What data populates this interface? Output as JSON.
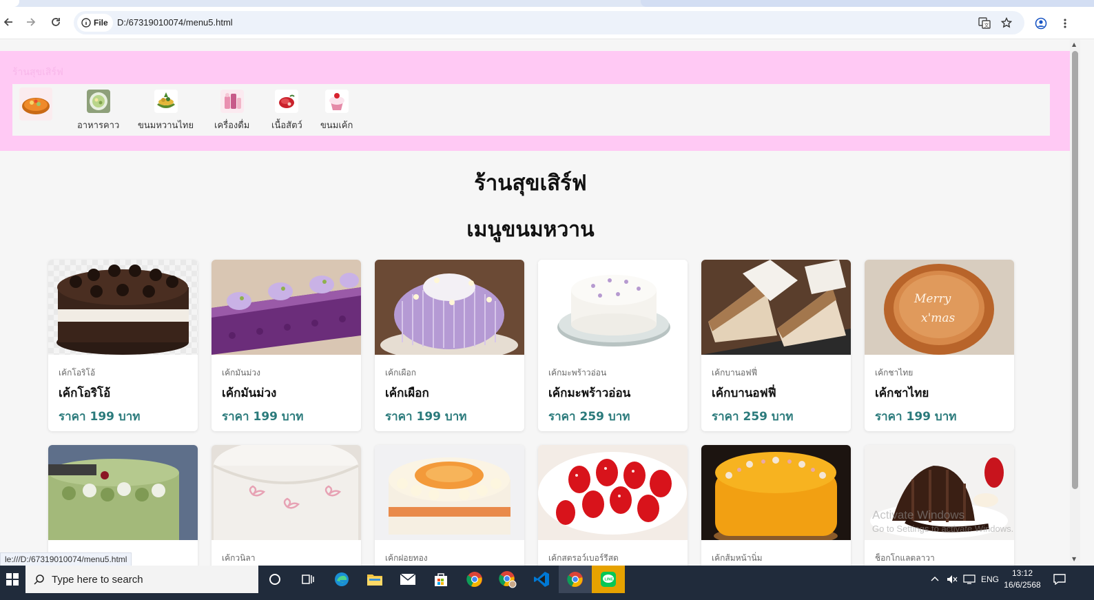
{
  "browser": {
    "chip_label": "File",
    "url": "D:/67319010074/menu5.html",
    "status_link": "le:///D:/67319010074/menu5.html"
  },
  "header": {
    "faint_text": "ร้านสุขเสิร์ฟ",
    "nav": [
      {
        "label": "",
        "icon": "food-bowl-icon"
      },
      {
        "label": "อาหารคาว",
        "icon": "savory-food-icon"
      },
      {
        "label": "ขนมหวานไทย",
        "icon": "thai-dessert-icon"
      },
      {
        "label": "เครื่องดื่ม",
        "icon": "drink-icon"
      },
      {
        "label": "เนื้อสัตว์",
        "icon": "meat-icon"
      },
      {
        "label": "ขนมเค้ก",
        "icon": "cake-icon"
      }
    ]
  },
  "main": {
    "shop_title": "ร้านสุขเสิร์ฟ",
    "menu_title": "เมนูขนมหวาน"
  },
  "cards": [
    {
      "category": "เค้กโอริโอ้",
      "name": "เค้กโอริโอ้",
      "price": "ราคา 199 บาท",
      "img": "oreo-cake-image"
    },
    {
      "category": "เค้กมันม่วง",
      "name": "เค้กมันม่วง",
      "price": "ราคา 199 บาท",
      "img": "purple-sweet-potato-cake-image"
    },
    {
      "category": "เค้กเผือก",
      "name": "เค้กเผือก",
      "price": "ราคา 199 บาท",
      "img": "taro-cake-image"
    },
    {
      "category": "เค้กมะพร้าวอ่อน",
      "name": "เค้กมะพร้าวอ่อน",
      "price": "ราคา 259 บาท",
      "img": "young-coconut-cake-image"
    },
    {
      "category": "เค้กบานอฟฟี่",
      "name": "เค้กบานอฟฟี่",
      "price": "ราคา 259 บาท",
      "img": "banoffee-cake-image"
    },
    {
      "category": "เค้กชาไทย",
      "name": "เค้กชาไทย",
      "price": "ราคา 199 บาท",
      "img": "thai-tea-cake-image"
    },
    {
      "category": "",
      "name": "",
      "price": "",
      "img": "green-tea-birthday-cake-image"
    },
    {
      "category": "เค้กวนิลา",
      "name": "",
      "price": "",
      "img": "vanilla-cake-image"
    },
    {
      "category": "เค้กฝอยทอง",
      "name": "",
      "price": "",
      "img": "foi-thong-cake-image"
    },
    {
      "category": "เค้กสตรอว์เบอร์รีสด",
      "name": "",
      "price": "",
      "img": "strawberry-cake-image"
    },
    {
      "category": "เค้กส้มหน้านิ่ม",
      "name": "",
      "price": "",
      "img": "orange-cake-image"
    },
    {
      "category": "ช็อกโกแลตลาวา",
      "name": "",
      "price": "",
      "img": "chocolate-lava-image"
    }
  ],
  "watermark": {
    "title": "Activate Windows",
    "sub": "Go to Settings to activate Windows."
  },
  "taskbar": {
    "search_placeholder": "Type here to search",
    "lang": "ENG",
    "time": "13:12",
    "date": "16/6/2568"
  }
}
